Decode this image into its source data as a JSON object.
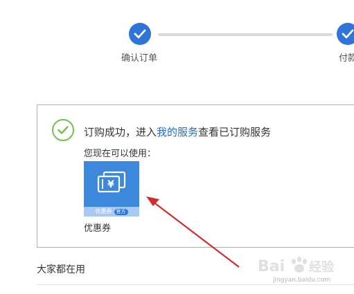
{
  "steps": [
    {
      "label": "确认订单",
      "done": true
    },
    {
      "label": "付款",
      "done": true
    }
  ],
  "success": {
    "msg_prefix": "订购成功，进入",
    "link": "我的服务",
    "msg_suffix": "查看已订购服务",
    "available_label": "您现在可以使用："
  },
  "coupon": {
    "icon": "coupon-ticket-icon",
    "symbol": "¥",
    "tag_text": "优惠券",
    "tag_badge": "官方",
    "name": "优惠券"
  },
  "section": {
    "title": "大家都在用"
  },
  "watermark": {
    "text": "jingyan.baidu.com"
  },
  "colors": {
    "primary": "#2f74d9",
    "success_border": "#8fd07a",
    "success_check": "#6cc24a",
    "link": "#2a6bc4",
    "coupon_bg": "#3b88dd",
    "annotation_arrow": "#d42a2a"
  }
}
